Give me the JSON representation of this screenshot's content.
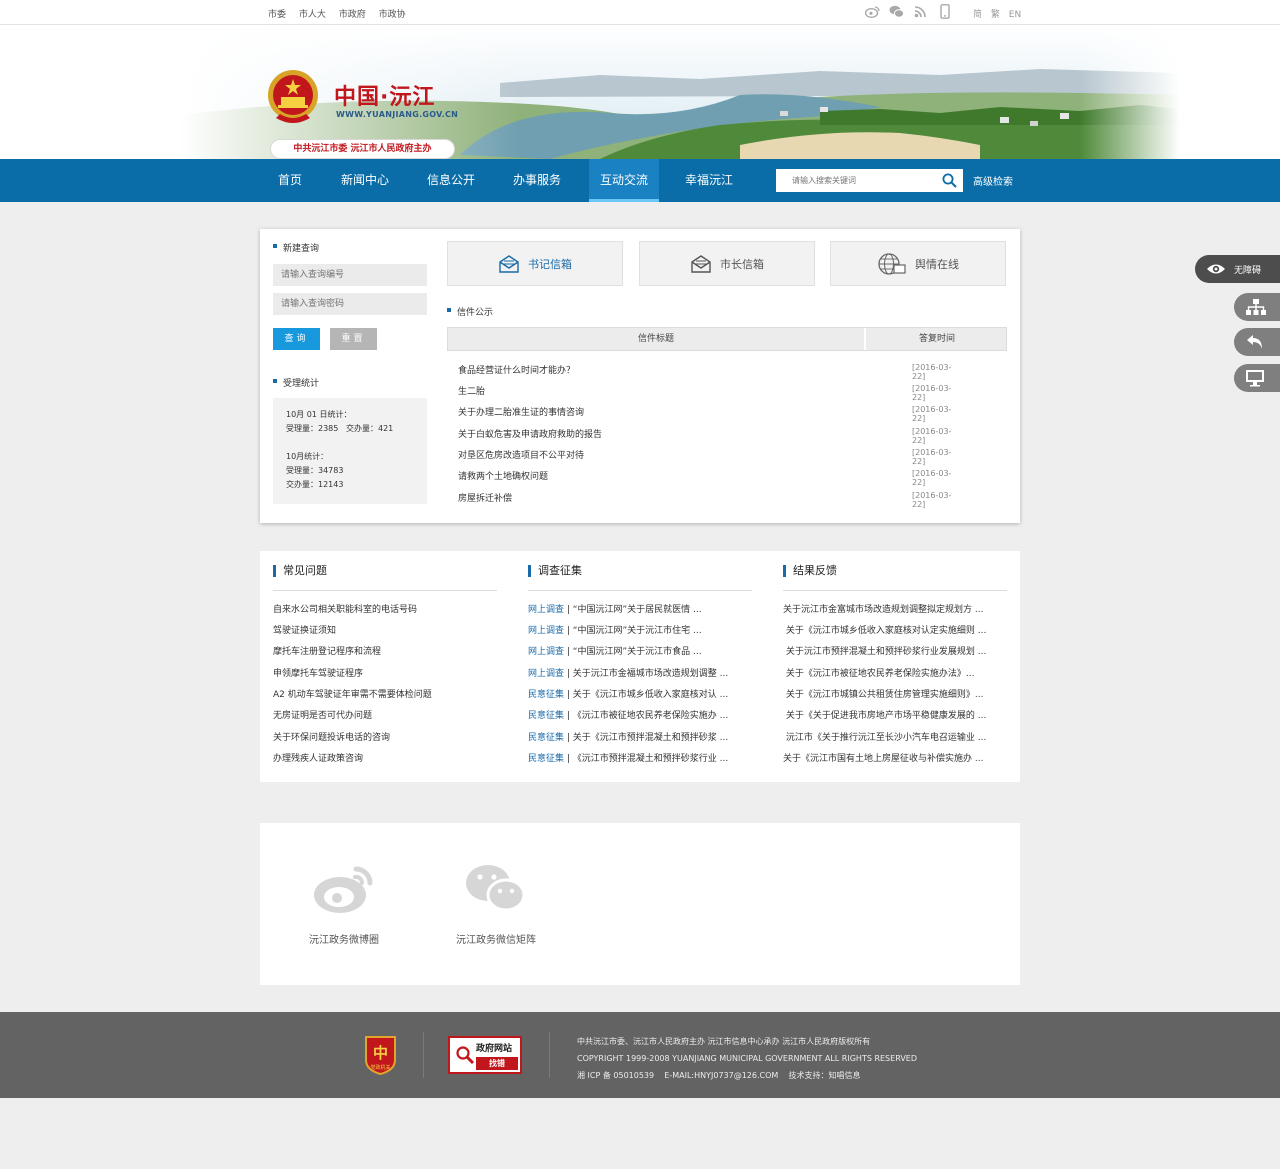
{
  "topbar": {
    "links": [
      "市委",
      "市人大",
      "市政府",
      "市政协"
    ],
    "languages": [
      "简",
      "繁",
      "EN"
    ],
    "icons": [
      "weibo-icon",
      "wechat-icon",
      "rss-icon",
      "mobile-icon"
    ]
  },
  "header": {
    "title": "中国·沅江",
    "url": "WWW.YUANJIANG.GOV.CN",
    "host": "中共沅江市委 沅江市人民政府主办"
  },
  "nav": {
    "items": [
      "首页",
      "新闻中心",
      "信息公开",
      "办事服务",
      "互动交流",
      "幸福沅江"
    ],
    "active_index": 4,
    "search_placeholder": "请输入搜索关键词",
    "advanced_search": "高级检索"
  },
  "query": {
    "title": "新建查询",
    "number_placeholder": "请输入查询编号",
    "password_placeholder": "请输入查询密码",
    "query_button": "查询",
    "reset_button": "重置"
  },
  "stats": {
    "title": "受理统计",
    "day_label": "10月 01 日统计：",
    "day_received": "受理量：2385",
    "day_done": "交办量：421",
    "month_label": "10月统计：",
    "month_received": "受理量：34783",
    "month_done": "交办量：12143"
  },
  "mailboxes": [
    {
      "label": "书记信箱",
      "icon": "envelope-icon"
    },
    {
      "label": "市长信箱",
      "icon": "envelope-icon"
    },
    {
      "label": "舆情在线",
      "icon": "globe-icon"
    }
  ],
  "letters": {
    "title": "信件公示",
    "col_title": "信件标题",
    "col_date": "答复时间",
    "rows": [
      {
        "title": "食品经营证什么时间才能办？",
        "date": "[2016-03-22]"
      },
      {
        "title": "生二胎",
        "date": "[2016-03-22]"
      },
      {
        "title": "关于办理二胎准生证的事情咨询",
        "date": "[2016-03-22]"
      },
      {
        "title": "关于白蚁危害及申请政府救助的报告",
        "date": "[2016-03-22]"
      },
      {
        "title": "对垦区危房改造项目不公平对待",
        "date": "[2016-03-22]"
      },
      {
        "title": "请救两个土地确权问题",
        "date": "[2016-03-22]"
      },
      {
        "title": "房屋拆迁补偿",
        "date": "[2016-03-22]"
      }
    ]
  },
  "faq": {
    "title": "常见问题",
    "items": [
      "自来水公司相关职能科室的电话号码",
      "驾驶证换证须知",
      "摩托车注册登记程序和流程",
      "申领摩托车驾驶证程序",
      "A2 机动车驾驶证年审需不需要体检问题",
      "无房证明是否可代办问题",
      "关于环保问题投诉电话的咨询",
      "办理残疾人证政策咨询"
    ]
  },
  "survey": {
    "title": "调查征集",
    "items": [
      {
        "tag": "网上调查",
        "text": "“中国沅江网”关于居民就医情 ..."
      },
      {
        "tag": "网上调查",
        "text": "“中国沅江网”关于沅江市住宅 ..."
      },
      {
        "tag": "网上调查",
        "text": "“中国沅江网”关于沅江市食品 ..."
      },
      {
        "tag": "网上调查",
        "text": "关于沅江市金福城市场改造规划调整 ..."
      },
      {
        "tag": "民意征集",
        "text": "关于《沅江市城乡低收入家庭核对认 ..."
      },
      {
        "tag": "民意征集",
        "text": "《沅江市被征地农民养老保险实施办 ..."
      },
      {
        "tag": "民意征集",
        "text": "关于《沅江市预拌混凝土和预拌砂浆 ..."
      },
      {
        "tag": "民意征集",
        "text": "《沅江市预拌混凝土和预拌砂浆行业 ..."
      }
    ]
  },
  "feedback": {
    "title": "结果反馈",
    "items": [
      "关于沅江市金富城市场改造规划调整拟定规划方 ...",
      " 关于《沅江市城乡低收入家庭核对认定实施细则 ...",
      " 关于沅江市预拌混凝土和预拌砂浆行业发展规划 ...",
      " 关于《沅江市被征地农民养老保险实施办法》...",
      " 关于《沅江市城镇公共租赁住房管理实施细则》...",
      " 关于《关于促进我市房地产市场平稳健康发展的 ...",
      " 沅江市《关于推行沅江至长沙小汽车电召运输业 ...",
      "关于《沅江市国有土地上房屋征收与补偿实施办 ..."
    ]
  },
  "social": [
    {
      "label": "沅江政务微博圈",
      "icon": "weibo-icon"
    },
    {
      "label": "沅江政务微信矩阵",
      "icon": "wechat-icon"
    }
  ],
  "footer": {
    "badge1": "党政机关",
    "badge2_top": "政府网站",
    "badge2_bottom": "找错",
    "line1": "中共沅江市委、沅江市人民政府主办 沅江市信息中心承办 沅江市人民政府版权所有",
    "line2": "COPYRIGHT 1999-2008 YUANJIANG MUNICIPAL GOVERNMENT ALL RIGHTS RESERVED",
    "line3": "湘 ICP 备 05010539    E-MAIL:HNYJ0737@126.COM    技术支持：知唱信息"
  },
  "floating": {
    "accessibility": "无障碍",
    "icons": [
      "eye-icon",
      "sitemap-icon",
      "back-icon",
      "monitor-icon"
    ]
  },
  "colors": {
    "nav": "#0b6da8",
    "accent": "#1899de",
    "brand_red": "#c0161c",
    "footer": "#636363"
  }
}
